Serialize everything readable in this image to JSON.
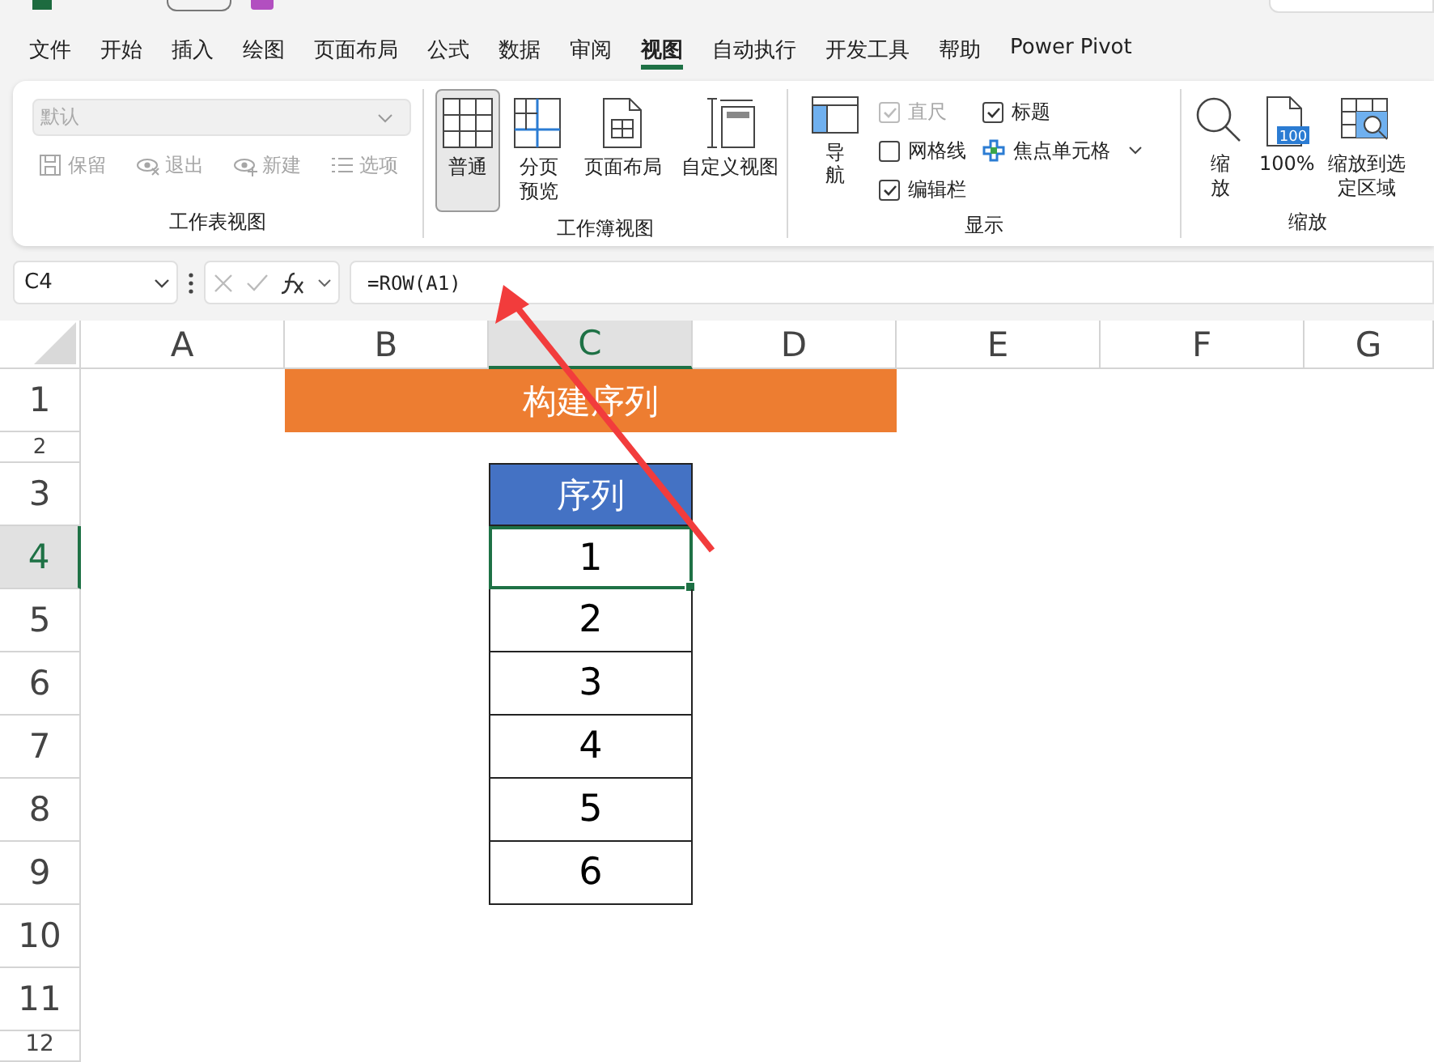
{
  "menu_tabs": [
    {
      "label": "文件",
      "selected": false
    },
    {
      "label": "开始",
      "selected": false
    },
    {
      "label": "插入",
      "selected": false
    },
    {
      "label": "绘图",
      "selected": false
    },
    {
      "label": "页面布局",
      "selected": false
    },
    {
      "label": "公式",
      "selected": false
    },
    {
      "label": "数据",
      "selected": false
    },
    {
      "label": "审阅",
      "selected": false
    },
    {
      "label": "视图",
      "selected": true
    },
    {
      "label": "自动执行",
      "selected": false
    },
    {
      "label": "开发工具",
      "selected": false
    },
    {
      "label": "帮助",
      "selected": false
    },
    {
      "label": "Power Pivot",
      "selected": false
    }
  ],
  "ribbon": {
    "sheet_view": {
      "label": "工作表视图",
      "dropdown": {
        "value": "默认",
        "disabled": true
      },
      "buttons": [
        {
          "label": "保留",
          "disabled": true
        },
        {
          "label": "退出",
          "disabled": true
        },
        {
          "label": "新建",
          "disabled": true
        },
        {
          "label": "选项",
          "disabled": true
        }
      ]
    },
    "workbook_view": {
      "label": "工作簿视图",
      "buttons": [
        {
          "label": "普通",
          "selected": true
        },
        {
          "label": "分页预览",
          "selected": false
        },
        {
          "label": "页面布局",
          "selected": false
        },
        {
          "label": "自定义视图",
          "selected": false
        }
      ]
    },
    "show": {
      "label": "显示",
      "navigation": {
        "label": "导航"
      },
      "checkboxes": [
        {
          "label": "直尺",
          "checked": true,
          "disabled": true
        },
        {
          "label": "网格线",
          "checked": false,
          "disabled": false
        },
        {
          "label": "编辑栏",
          "checked": true,
          "disabled": false
        },
        {
          "label": "标题",
          "checked": true,
          "disabled": false
        }
      ],
      "focus_cell": {
        "label": "焦点单元格"
      }
    },
    "zoom": {
      "label": "缩放",
      "buttons": [
        {
          "label": "缩放"
        },
        {
          "label": "100%",
          "icon_text": "100"
        },
        {
          "label": "缩放到选定区域"
        }
      ]
    }
  },
  "formula_bar": {
    "name_box": "C4",
    "formula": "=ROW(A1)"
  },
  "sheet": {
    "columns": [
      {
        "label": "A",
        "selected": false
      },
      {
        "label": "B",
        "selected": false
      },
      {
        "label": "C",
        "selected": true
      },
      {
        "label": "D",
        "selected": false
      },
      {
        "label": "E",
        "selected": false
      },
      {
        "label": "F",
        "selected": false
      },
      {
        "label": "G",
        "selected": false
      }
    ],
    "rows": [
      {
        "label": "1",
        "selected": false,
        "kind": "normal"
      },
      {
        "label": "2",
        "selected": false,
        "kind": "short"
      },
      {
        "label": "3",
        "selected": false,
        "kind": "normal"
      },
      {
        "label": "4",
        "selected": true,
        "kind": "normal"
      },
      {
        "label": "5",
        "selected": false,
        "kind": "normal"
      },
      {
        "label": "6",
        "selected": false,
        "kind": "normal"
      },
      {
        "label": "7",
        "selected": false,
        "kind": "normal"
      },
      {
        "label": "8",
        "selected": false,
        "kind": "normal"
      },
      {
        "label": "9",
        "selected": false,
        "kind": "normal"
      },
      {
        "label": "10",
        "selected": false,
        "kind": "normal"
      },
      {
        "label": "11",
        "selected": false,
        "kind": "normal"
      },
      {
        "label": "12",
        "selected": false,
        "kind": "normal"
      }
    ],
    "title_banner": {
      "text": "构建序列"
    },
    "table": {
      "header": "序列",
      "cells": [
        {
          "text": "1",
          "selected": true
        },
        {
          "text": "2",
          "selected": false
        },
        {
          "text": "3",
          "selected": false
        },
        {
          "text": "4",
          "selected": false
        },
        {
          "text": "5",
          "selected": false
        },
        {
          "text": "6",
          "selected": false
        }
      ]
    }
  }
}
